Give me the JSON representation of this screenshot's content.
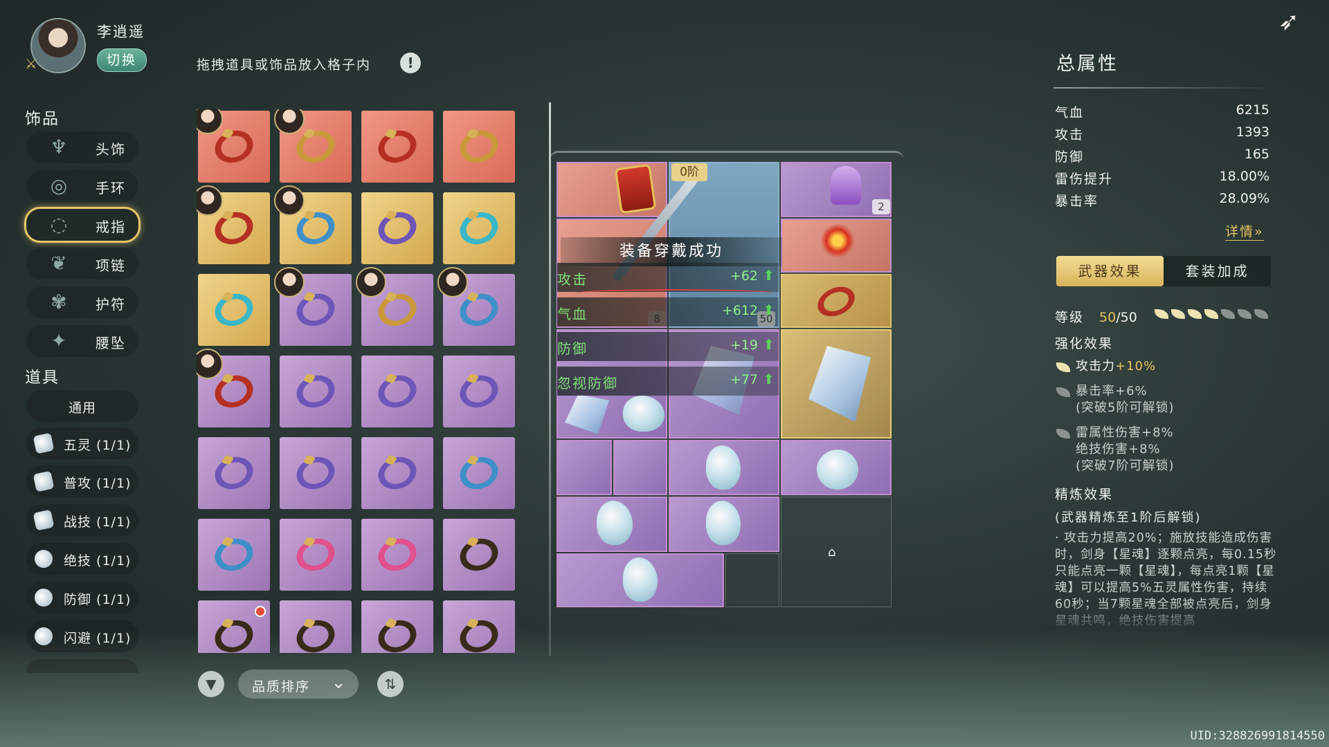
{
  "character": {
    "name": "李逍遥",
    "switch_label": "切换"
  },
  "sidebar": {
    "accessories_title": "饰品",
    "categories": [
      {
        "label": "头饰",
        "icon": "hairpin-icon"
      },
      {
        "label": "手环",
        "icon": "bracelet-icon"
      },
      {
        "label": "戒指",
        "icon": "ring-icon",
        "active": true
      },
      {
        "label": "项链",
        "icon": "necklace-icon"
      },
      {
        "label": "护符",
        "icon": "amulet-icon"
      },
      {
        "label": "腰坠",
        "icon": "pendant-icon"
      }
    ],
    "items_title": "道具",
    "general_label": "通用",
    "tools": [
      {
        "label": "五灵 (1/1)"
      },
      {
        "label": "普攻 (1/1)"
      },
      {
        "label": "战技 (1/1)"
      },
      {
        "label": "绝技 (1/1)"
      },
      {
        "label": "防御 (1/1)"
      },
      {
        "label": "闪避 (1/1)"
      }
    ]
  },
  "inventory": {
    "hint": "拖拽道具或饰品放入格子内",
    "sort_label": "品质排序"
  },
  "board": {
    "tier_label": "0阶",
    "bell_count": "2",
    "count_8": "8",
    "count_50": "50",
    "success_text": "装备穿戴成功",
    "stats": [
      {
        "label": "攻击",
        "value": "+62"
      },
      {
        "label": "气血",
        "value": "+612"
      },
      {
        "label": "防御",
        "value": "+19"
      },
      {
        "label": "忽视防御",
        "value": "+77"
      }
    ]
  },
  "total": {
    "title": "总属性",
    "attributes": [
      {
        "label": "气血",
        "value": "6215"
      },
      {
        "label": "攻击",
        "value": "1393"
      },
      {
        "label": "防御",
        "value": "165"
      },
      {
        "label": "雷伤提升",
        "value": "18.00%"
      },
      {
        "label": "暴击率",
        "value": "28.09%"
      }
    ],
    "details_label": "详情»",
    "tabs": [
      "武器效果",
      "套装加成"
    ],
    "level_label": "等级",
    "level_current": "50",
    "level_max": "/50",
    "enhance_title": "强化效果",
    "enhance": [
      {
        "text": "攻击力",
        "bonus": "+10%",
        "active": true
      },
      {
        "text": "暴击率+6%",
        "lock": "(突破5阶可解锁)",
        "active": false
      },
      {
        "text": "雷属性伤害+8%",
        "line2": "绝技伤害+8%",
        "lock": "(突破7阶可解锁)",
        "active": false
      }
    ],
    "refine_title": "精炼效果",
    "refine_lock": "(武器精炼至1阶后解锁)",
    "refine_desc": "· 攻击力提高20%；施放技能造成伤害时，剑身【星魂】逐颗点亮，每0.15秒只能点亮一颗【星魂】，每点亮1颗【星魂】可以提高5%五灵属性伤害，持续60秒；当7颗星魂全部被点亮后，剑身星魂共鸣，绝技伤害提高"
  },
  "uid": "UID:328826991814550",
  "colors": {
    "accent_gold": "#e8c45f",
    "stat_green": "#7fe07a",
    "switch_green": "#4f9c84"
  }
}
